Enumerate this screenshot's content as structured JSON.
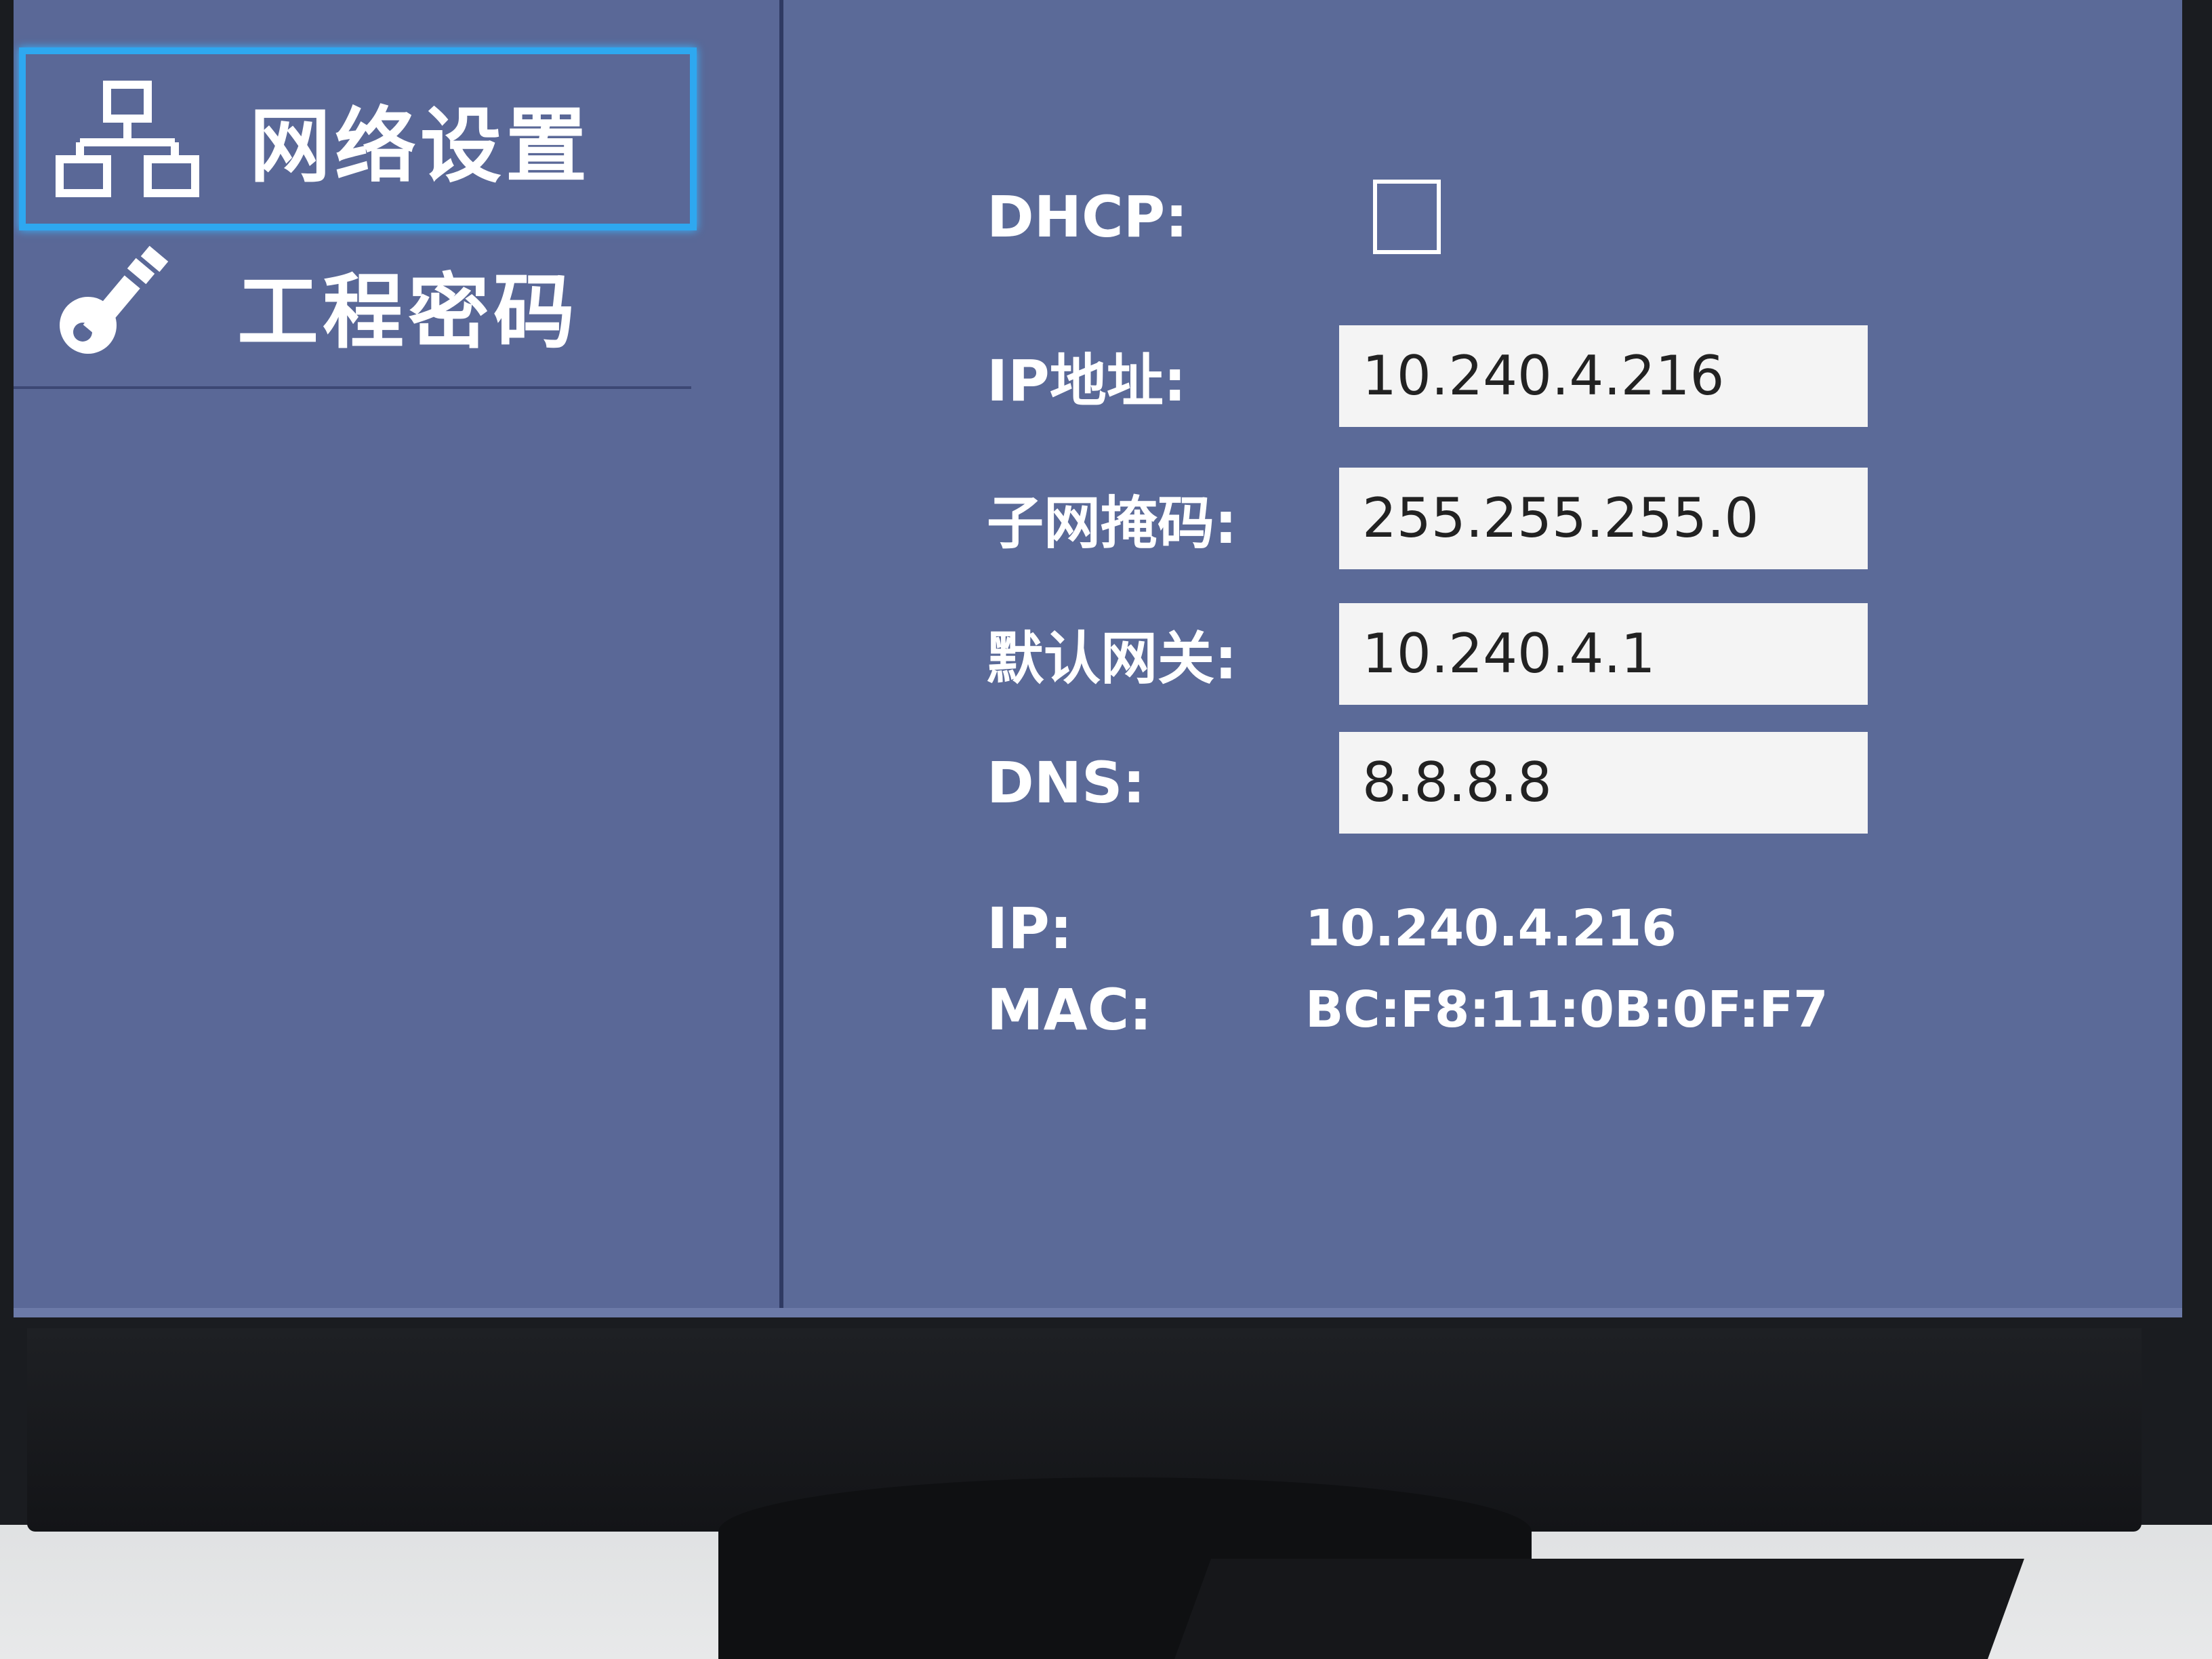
{
  "sidebar": {
    "items": [
      {
        "label": "网络设置",
        "icon": "network-icon",
        "selected": true
      },
      {
        "label": "工程密码",
        "icon": "key-icon",
        "selected": false
      }
    ]
  },
  "form": {
    "dhcp_label": "DHCP:",
    "dhcp_checked": false,
    "ip_label": "IP地址:",
    "ip_value": "10.240.4.216",
    "subnet_label": "子网掩码:",
    "subnet_value": "255.255.255.0",
    "gateway_label": "默认网关:",
    "gateway_value": "10.240.4.1",
    "dns_label": "DNS:",
    "dns_value": "8.8.8.8"
  },
  "info": {
    "ip_label": "IP:",
    "ip_value": "10.240.4.216",
    "mac_label": "MAC:",
    "mac_value": "BC:F8:11:0B:0F:F7"
  },
  "colors": {
    "screen_bg": "#5b6a98",
    "selection_border": "#2ea8f0",
    "input_bg": "#f4f4f4"
  }
}
